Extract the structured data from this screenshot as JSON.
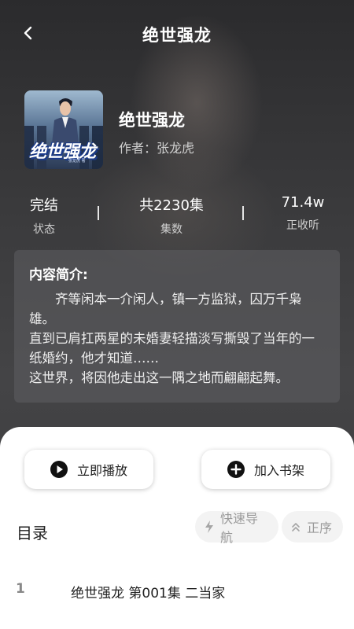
{
  "header": {
    "title": "绝世强龙"
  },
  "book": {
    "title": "绝世强龙",
    "author": "作者：张龙虎",
    "cover_text": "绝世强龙",
    "cover_sub": "张龙虎 著"
  },
  "stats": [
    {
      "value": "完结",
      "label": "状态"
    },
    {
      "value": "共2230集",
      "label": "集数"
    },
    {
      "value": "71.4w",
      "label": "正收听"
    }
  ],
  "intro": {
    "heading": "内容简介:",
    "text": "　　齐等闲本一介闲人，镇一方监狱，囚万千枭雄。\n直到已肩扛两星的未婚妻轻描淡写撕毁了当年的一纸婚约，他才知道……\n这世界，将因他走出这一隅之地而翩翩起舞。"
  },
  "actions": {
    "play_label": "立即播放",
    "shelf_label": "加入书架"
  },
  "toc": {
    "title": "目录",
    "quick_nav_label": "快速导航",
    "order_label": "正序"
  },
  "chapters": [
    {
      "num": "1",
      "name": "绝世强龙 第001集 二当家"
    }
  ]
}
